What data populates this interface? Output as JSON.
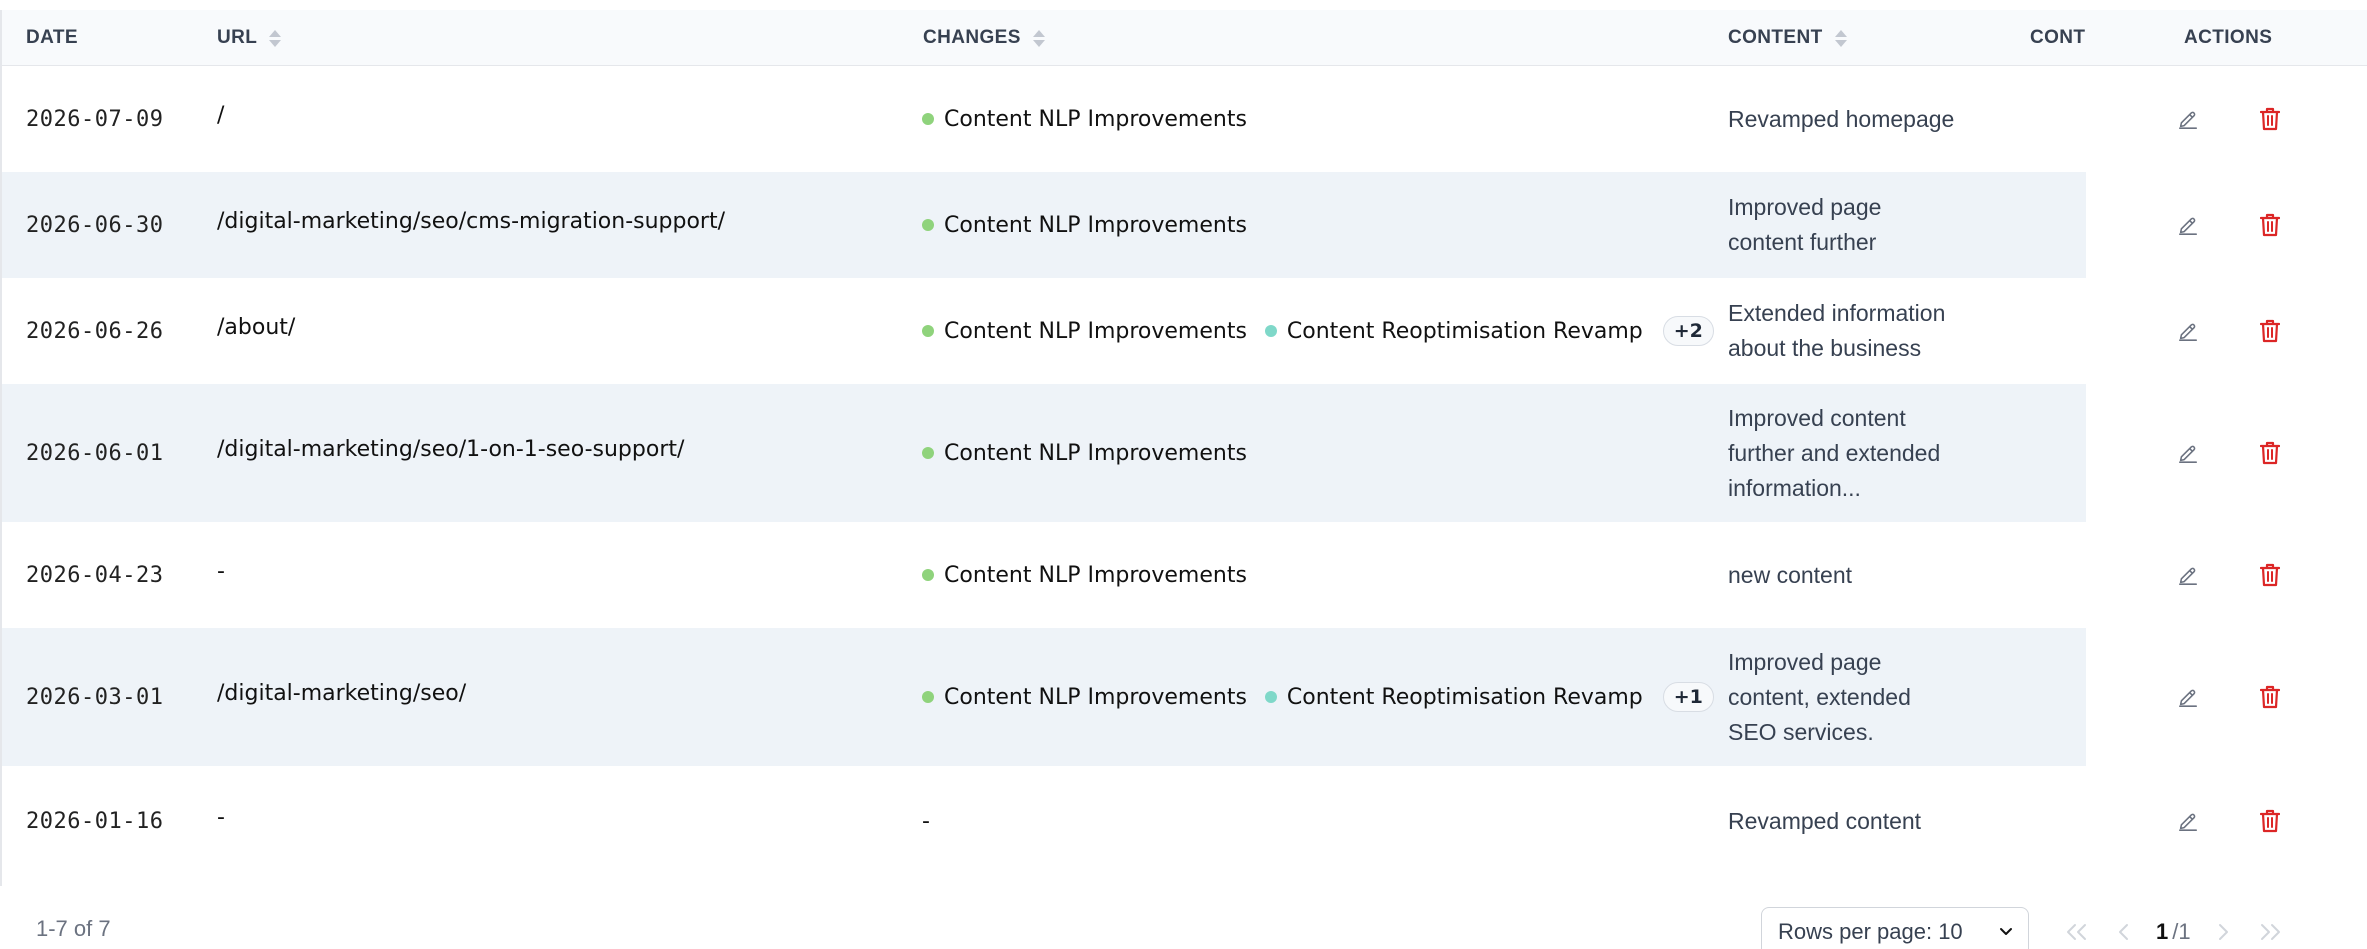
{
  "table": {
    "headers": {
      "date": "DATE",
      "url": "URL",
      "changes": "CHANGES",
      "content": "CONTENT",
      "cont": "CONT",
      "actions": "ACTIONS"
    },
    "rows": [
      {
        "date": "2026-07-09",
        "url": "/",
        "changes": [
          {
            "label": "Content NLP Improvements",
            "color": "#8fd37c"
          }
        ],
        "more": "",
        "content": [
          "Revamped homepage"
        ]
      },
      {
        "date": "2026-06-30",
        "url": "/digital-marketing/seo/cms-migration-support/",
        "changes": [
          {
            "label": "Content NLP Improvements",
            "color": "#8fd37c"
          }
        ],
        "more": "",
        "content": [
          "Improved page",
          "content further"
        ]
      },
      {
        "date": "2026-06-26",
        "url": "/about/",
        "changes": [
          {
            "label": "Content NLP Improvements",
            "color": "#8fd37c"
          },
          {
            "label": "Content Reoptimisation Revamp",
            "color": "#7fd8c9"
          }
        ],
        "more": "+2",
        "content": [
          "Extended information",
          "about the business"
        ]
      },
      {
        "date": "2026-06-01",
        "url": "/digital-marketing/seo/1-on-1-seo-support/",
        "changes": [
          {
            "label": "Content NLP Improvements",
            "color": "#8fd37c"
          }
        ],
        "more": "",
        "content": [
          "Improved content",
          "further and extended",
          "information..."
        ]
      },
      {
        "date": "2026-04-23",
        "url": "-",
        "changes": [
          {
            "label": "Content NLP Improvements",
            "color": "#8fd37c"
          }
        ],
        "more": "",
        "content": [
          "new content"
        ]
      },
      {
        "date": "2026-03-01",
        "url": "/digital-marketing/seo/",
        "changes": [
          {
            "label": "Content NLP Improvements",
            "color": "#8fd37c"
          },
          {
            "label": "Content Reoptimisation Revamp",
            "color": "#7fd8c9"
          }
        ],
        "more": "+1",
        "content": [
          "Improved page",
          "content, extended",
          "SEO services."
        ]
      },
      {
        "date": "2026-01-16",
        "url": "-",
        "changes": [],
        "changes_text": "-",
        "more": "",
        "content": [
          "Revamped content"
        ]
      }
    ]
  },
  "icons": {
    "edit": "pencil-icon",
    "delete": "trash-icon",
    "sort": "sort-icon",
    "chevron": "chevron-down-icon"
  },
  "colors": {
    "delete": "#dc2626",
    "alt_row": "#eef3f8",
    "header_bg": "#f8fafc"
  },
  "footer": {
    "count": "1-7 of 7",
    "rows_per_page": "Rows per page: 10",
    "current_page": "1",
    "total_pages": "/1"
  }
}
